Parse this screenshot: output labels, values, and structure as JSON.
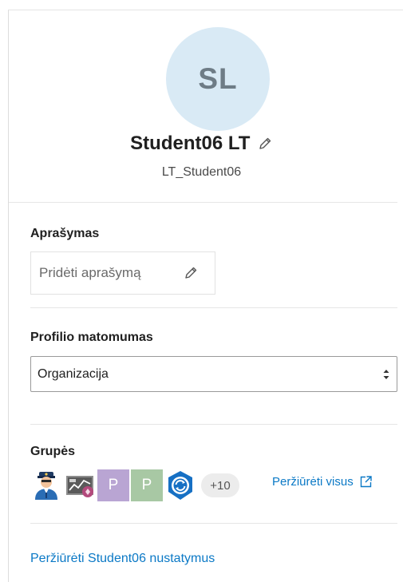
{
  "profile": {
    "initials": "SL",
    "full_name": "Student06 LT",
    "username": "LT_Student06"
  },
  "description": {
    "title": "Aprašymas",
    "placeholder": "Pridėti aprašymą"
  },
  "visibility": {
    "title": "Profilio matomumas",
    "selected": "Organizacija"
  },
  "groups": {
    "title": "Grupės",
    "items": [
      {
        "icon": "police-officer-icon"
      },
      {
        "icon": "map-dashboard-icon"
      },
      {
        "label": "P",
        "color": "#b9a5d3"
      },
      {
        "label": "P",
        "color": "#a8c8a4"
      },
      {
        "icon": "sync-shield-icon"
      }
    ],
    "more_count": "+10",
    "view_all": "Peržiūrėti visus"
  },
  "settings_link": "Peržiūrėti Student06 nustatymus",
  "colors": {
    "link": "#0b79c6",
    "avatar_bg": "#d9eaf5"
  }
}
